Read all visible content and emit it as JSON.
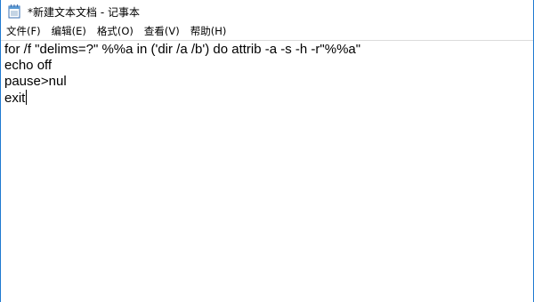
{
  "window": {
    "title": "*新建文本文档 - 记事本",
    "icon": "notepad-icon"
  },
  "menubar": {
    "items": [
      {
        "label": "文件(F)"
      },
      {
        "label": "编辑(E)"
      },
      {
        "label": "格式(O)"
      },
      {
        "label": "查看(V)"
      },
      {
        "label": "帮助(H)"
      }
    ]
  },
  "editor": {
    "lines": [
      "for /f \"delims=?\" %%a in ('dir /a /b') do attrib -a -s -h -r\"%%a\"",
      "echo off",
      "pause>nul",
      "exit"
    ]
  },
  "colors": {
    "window_border": "#1f7ad1",
    "text": "#000000",
    "background": "#ffffff"
  }
}
